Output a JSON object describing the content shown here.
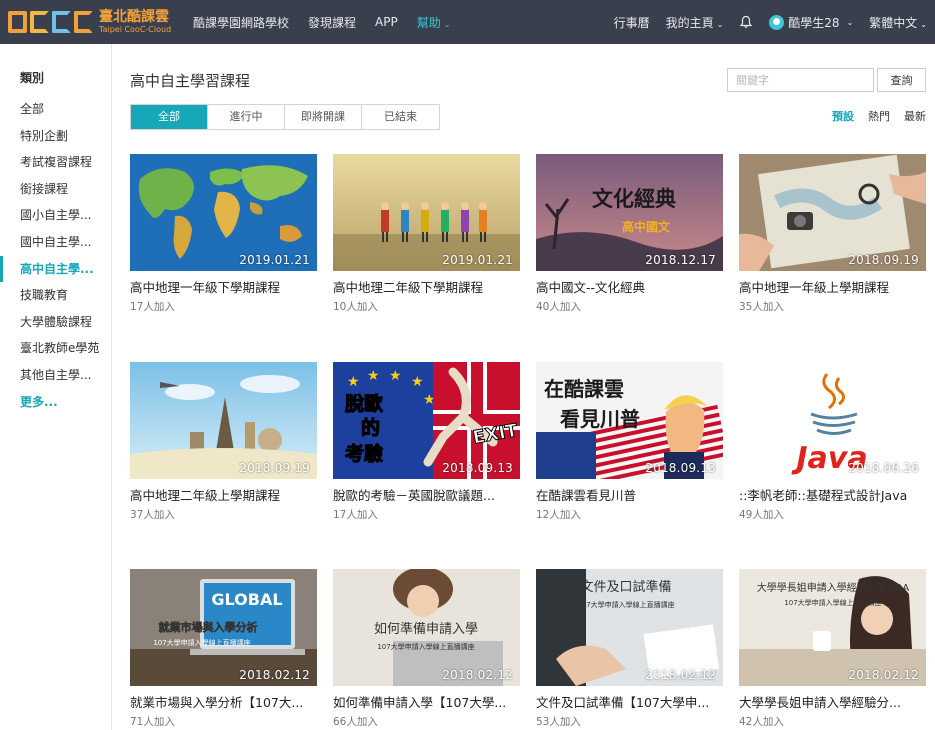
{
  "logo": {
    "zh": "臺北酷課雲",
    "en": "Taipei CooC-Cloud"
  },
  "nav_left": [
    {
      "label": "酷課學園網路學校",
      "active": false
    },
    {
      "label": "發現課程",
      "active": false
    },
    {
      "label": "APP",
      "active": false
    },
    {
      "label": "幫助",
      "active": true,
      "dropdown": true
    }
  ],
  "nav_right": {
    "calendar": "行事曆",
    "my_home": "我的主頁",
    "user": "酷學生28",
    "language": "繁體中文",
    "caret": "⌄"
  },
  "sidebar": {
    "title": "類別",
    "items": [
      {
        "label": "全部"
      },
      {
        "label": "特別企劃"
      },
      {
        "label": "考試複習課程"
      },
      {
        "label": "銜接課程"
      },
      {
        "label": "國小自主學..."
      },
      {
        "label": "國中自主學..."
      },
      {
        "label": "高中自主學...",
        "active": true
      },
      {
        "label": "技職教育"
      },
      {
        "label": "大學體驗課程"
      },
      {
        "label": "臺北教師e學苑"
      },
      {
        "label": "其他自主學..."
      },
      {
        "label": "更多...",
        "more": true
      }
    ]
  },
  "main": {
    "title": "高中自主學習課程",
    "search": {
      "placeholder": "關鍵字",
      "button": "查詢"
    },
    "tabs": [
      {
        "label": "全部",
        "active": true
      },
      {
        "label": "進行中"
      },
      {
        "label": "即將開課"
      },
      {
        "label": "已結束"
      }
    ],
    "sort": [
      {
        "label": "預設",
        "active": true
      },
      {
        "label": "熱門"
      },
      {
        "label": "最新"
      }
    ],
    "courses": [
      {
        "title": "高中地理一年級下學期課程",
        "count": "17人加入",
        "date": "2019.01.21",
        "thumb": "map"
      },
      {
        "title": "高中地理二年級下學期課程",
        "count": "10人加入",
        "date": "2019.01.21",
        "thumb": "travelers"
      },
      {
        "title": "高中國文--文化經典",
        "count": "40人加入",
        "date": "2018.12.17",
        "thumb": "culture",
        "overlay": [
          "文化經典",
          "高中國文"
        ]
      },
      {
        "title": "高中地理一年級上學期課程",
        "count": "35人加入",
        "date": "2018.09.19",
        "thumb": "desk-map"
      },
      {
        "title": "高中地理二年級上學期課程",
        "count": "37人加入",
        "date": "2018.09.19",
        "thumb": "landmarks"
      },
      {
        "title": "脫歐的考驗－英國脫歐議題...",
        "count": "17人加入",
        "date": "2018.09.13",
        "thumb": "brexit",
        "overlay": [
          "脫歐",
          "的",
          "考驗",
          "EXIT"
        ]
      },
      {
        "title": "在酷課雲看見川普",
        "count": "12人加入",
        "date": "2018.09.13",
        "thumb": "trump",
        "overlay": [
          "在酷課雲",
          "看見川普"
        ]
      },
      {
        "title": "::李帆老師::基礎程式設計Java",
        "count": "49人加入",
        "date": "2018.06.26",
        "thumb": "java",
        "overlay": [
          "Java"
        ]
      },
      {
        "title": "就業市場與入學分析【107大...",
        "count": "71人加入",
        "date": "2018.02.12",
        "thumb": "global",
        "overlay": [
          "GLOBAL",
          "就業市場與入學分析",
          "107大學申請入學線上直播講座"
        ]
      },
      {
        "title": "如何準備申請入學【107大學...",
        "count": "66人加入",
        "date": "2018.02.12",
        "thumb": "prepare",
        "overlay": [
          "如何準備申請入學",
          "107大學申請入學線上直播講座"
        ]
      },
      {
        "title": "文件及口試準備【107大學申...",
        "count": "53人加入",
        "date": "2018.02.12",
        "thumb": "interview",
        "overlay": [
          "文件及口試準備",
          "107大學申請入學線上直播講座"
        ]
      },
      {
        "title": "大學學長姐申請入學經驗分...",
        "count": "42人加入",
        "date": "2018.02.12",
        "thumb": "experience",
        "overlay": [
          "大學學長姐申請入學經驗分享&QA",
          "107大學申請入學線上直播講座"
        ]
      }
    ]
  }
}
